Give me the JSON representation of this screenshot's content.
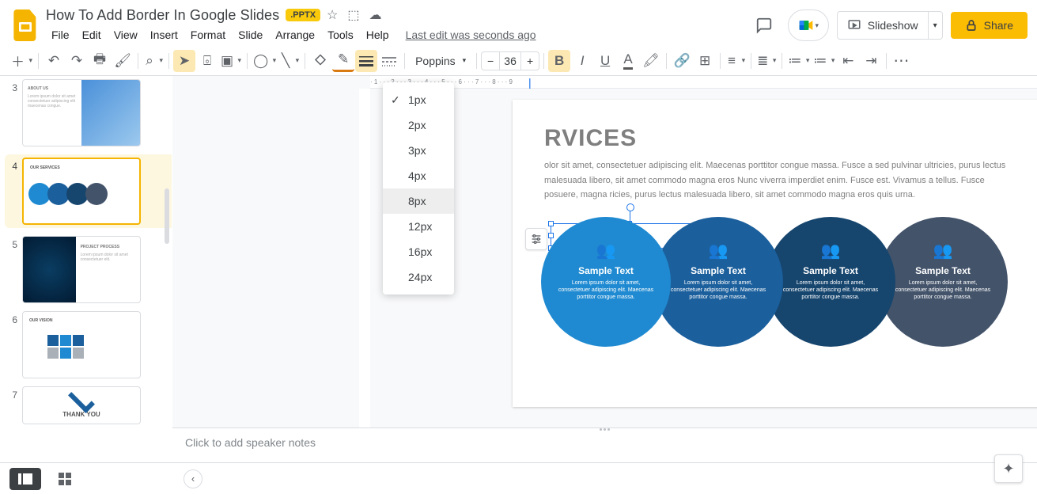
{
  "doc": {
    "title": "How To Add Border In Google Slides",
    "ext_badge": ".PPTX",
    "last_edit": "Last edit was seconds ago"
  },
  "menu": {
    "file": "File",
    "edit": "Edit",
    "view": "View",
    "insert": "Insert",
    "format": "Format",
    "slide": "Slide",
    "arrange": "Arrange",
    "tools": "Tools",
    "help": "Help"
  },
  "header_actions": {
    "slideshow": "Slideshow",
    "share": "Share"
  },
  "toolbar": {
    "font_name": "Poppins",
    "font_size": "36"
  },
  "border_width_menu": {
    "items": [
      "1px",
      "2px",
      "3px",
      "4px",
      "8px",
      "12px",
      "16px",
      "24px"
    ],
    "checked": "1px",
    "highlighted": "8px"
  },
  "slide": {
    "title": "RVICES",
    "body": "olor sit amet, consectetuer adipiscing elit. Maecenas porttitor congue massa. Fusce a sed pulvinar ultricies, purus lectus malesuada libero, sit amet commodo magna eros Nunc viverra imperdiet enim. Fusce est. Vivamus a tellus. Fusce posuere, magna ricies, purus lectus malesuada libero, sit amet commodo magna eros quis urna.",
    "circles": [
      {
        "title": "Sample Text",
        "desc": "Lorem ipsum dolor sit amet, consectetuer adipiscing elit. Maecenas porttitor congue massa."
      },
      {
        "title": "Sample Text",
        "desc": "Lorem ipsum dolor sit amet, consectetuer adipiscing elit. Maecenas porttitor congue massa."
      },
      {
        "title": "Sample Text",
        "desc": "Lorem ipsum dolor sit amet, consectetuer adipiscing elit. Maecenas porttitor congue massa."
      },
      {
        "title": "Sample Text",
        "desc": "Lorem ipsum dolor sit amet, consectetuer adipiscing elit. Maecenas porttitor congue massa."
      }
    ]
  },
  "thumbs": {
    "n3": "3",
    "n4": "4",
    "n5": "5",
    "n6": "6",
    "n7": "7",
    "t2_title": "ABOUT US",
    "t3_title": "OUR SERVICES",
    "t4_title": "PROJECT PROCESS",
    "t5_title": "OUR VISION",
    "t6_title": "THANK YOU"
  },
  "notes": {
    "placeholder": "Click to add speaker notes"
  }
}
